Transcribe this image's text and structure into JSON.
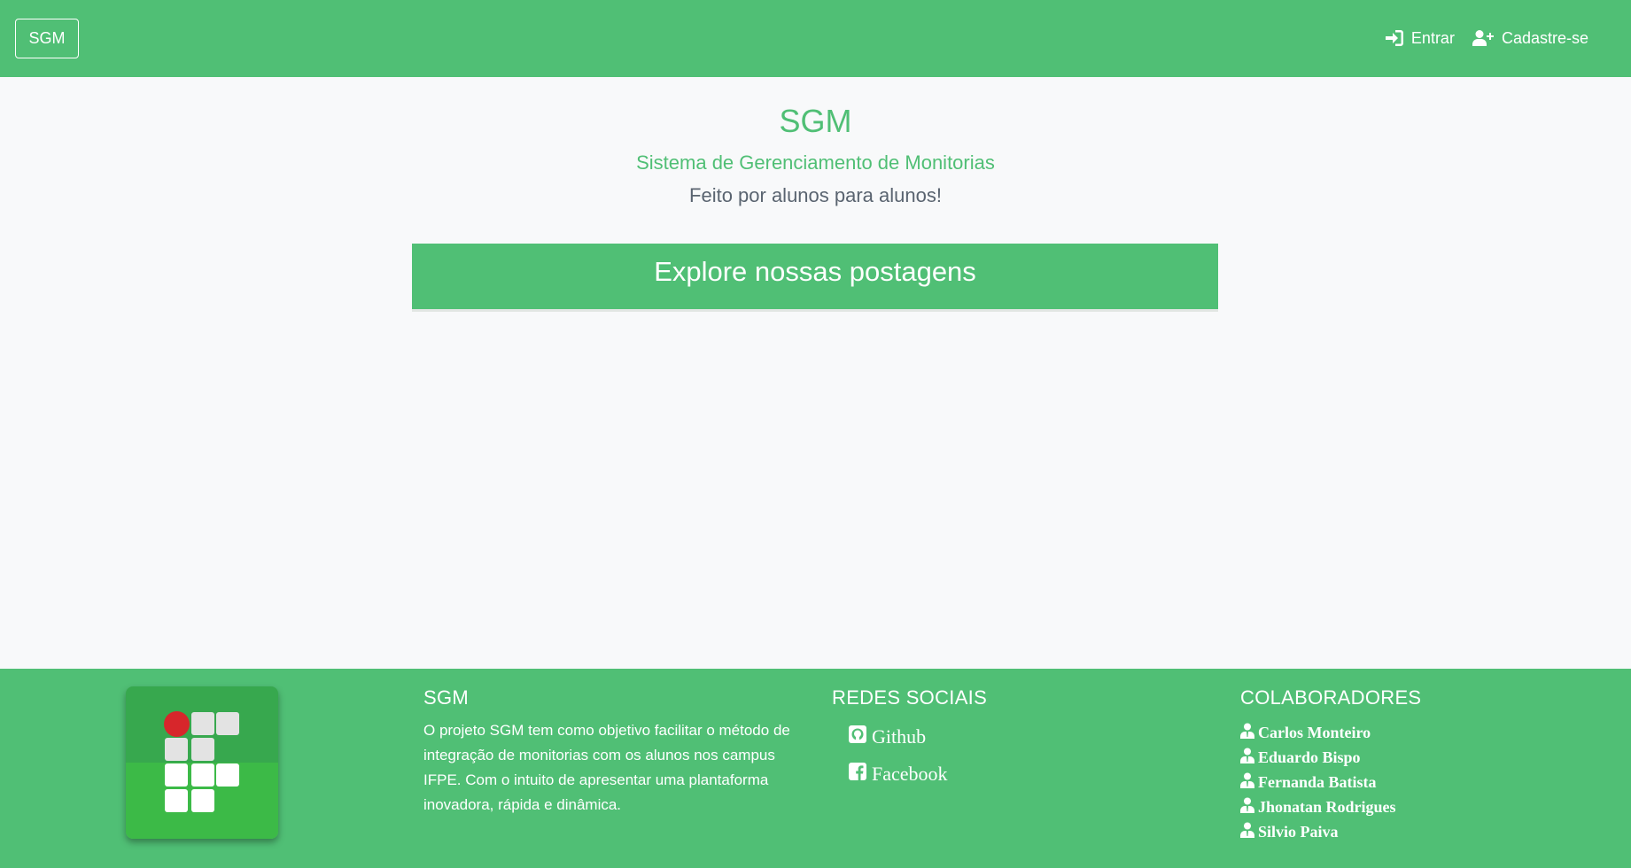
{
  "navbar": {
    "brand": "SGM",
    "login_label": "Entrar",
    "signup_label": "Cadastre-se",
    "login_icon": "sign-in-icon",
    "signup_icon": "user-plus-icon"
  },
  "hero": {
    "title": "SGM",
    "subtitle": "Sistema de Gerenciamento de Monitorias",
    "tagline": "Feito por alunos para alunos!",
    "explore_label": "Explore nossas postagens"
  },
  "footer": {
    "about": {
      "title": "SGM",
      "text": "O projeto SGM tem como objetivo facilitar o método de integração de monitorias com os alunos nos campus IFPE. Com o intuito de apresentar uma plantaforma inovadora, rápida e dinâmica."
    },
    "social": {
      "title": "REDES SOCIAIS",
      "links": [
        {
          "label": "Github",
          "icon": "github-icon"
        },
        {
          "label": "Facebook",
          "icon": "facebook-icon"
        }
      ]
    },
    "collaborators": {
      "title": "COLABORADORES",
      "names": [
        "Carlos Monteiro",
        "Eduardo Bispo",
        "Fernanda Batista",
        "Jhonatan Rodrigues",
        "Silvio Paiva"
      ]
    },
    "logo_icon": "ifpe-logo"
  },
  "colors": {
    "primary": "#50bf75",
    "background": "#f8f9fa",
    "text_muted": "#5a6470",
    "logo_red": "#d7262b"
  }
}
